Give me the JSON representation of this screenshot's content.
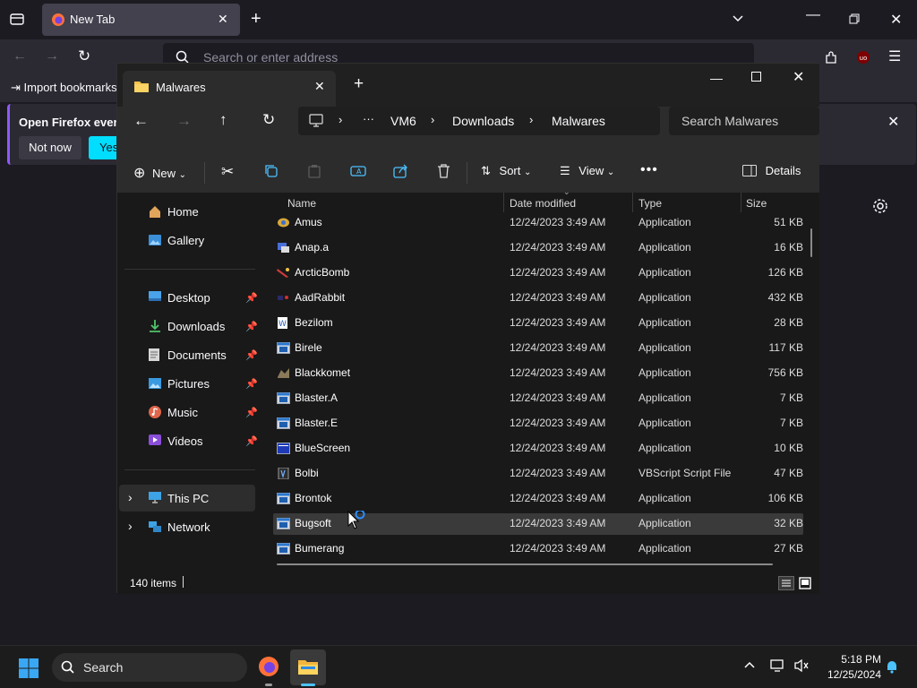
{
  "browser": {
    "tab_title": "New Tab",
    "url_placeholder": "Search or enter address",
    "bookmark_import": "Import bookmarks",
    "notification": {
      "text": "Open Firefox every",
      "not_now": "Not now",
      "yes": "Yes,"
    }
  },
  "explorer": {
    "tab_title": "Malwares",
    "breadcrumb": [
      "VM6",
      "Downloads",
      "Malwares"
    ],
    "search_placeholder": "Search Malwares",
    "commands": {
      "new": "New",
      "sort": "Sort",
      "view": "View",
      "details": "Details"
    },
    "nav": {
      "home": "Home",
      "gallery": "Gallery",
      "desktop": "Desktop",
      "downloads": "Downloads",
      "documents": "Documents",
      "pictures": "Pictures",
      "music": "Music",
      "videos": "Videos",
      "this_pc": "This PC",
      "network": "Network"
    },
    "columns": {
      "name": "Name",
      "date": "Date modified",
      "type": "Type",
      "size": "Size"
    },
    "files": [
      {
        "name": "Amus",
        "date": "12/24/2023 3:49 AM",
        "type": "Application",
        "size": "51 KB",
        "icon": "amus-icon"
      },
      {
        "name": "Anap.a",
        "date": "12/24/2023 3:49 AM",
        "type": "Application",
        "size": "16 KB",
        "icon": "anap-icon"
      },
      {
        "name": "ArcticBomb",
        "date": "12/24/2023 3:49 AM",
        "type": "Application",
        "size": "126 KB",
        "icon": "arcticbomb-icon"
      },
      {
        "name": "AadRabbit",
        "date": "12/24/2023 3:49 AM",
        "type": "Application",
        "size": "432 KB",
        "icon": "aadrabbit-icon"
      },
      {
        "name": "Bezilom",
        "date": "12/24/2023 3:49 AM",
        "type": "Application",
        "size": "28 KB",
        "icon": "word-doc-icon"
      },
      {
        "name": "Birele",
        "date": "12/24/2023 3:49 AM",
        "type": "Application",
        "size": "117 KB",
        "icon": "app-window-icon"
      },
      {
        "name": "Blackkomet",
        "date": "12/24/2023 3:49 AM",
        "type": "Application",
        "size": "756 KB",
        "icon": "blackkomet-icon"
      },
      {
        "name": "Blaster.A",
        "date": "12/24/2023 3:49 AM",
        "type": "Application",
        "size": "7 KB",
        "icon": "app-window-icon"
      },
      {
        "name": "Blaster.E",
        "date": "12/24/2023 3:49 AM",
        "type": "Application",
        "size": "7 KB",
        "icon": "app-window-icon"
      },
      {
        "name": "BlueScreen",
        "date": "12/24/2023 3:49 AM",
        "type": "Application",
        "size": "10 KB",
        "icon": "bluescreen-icon"
      },
      {
        "name": "Bolbi",
        "date": "12/24/2023 3:49 AM",
        "type": "VBScript Script File",
        "size": "47 KB",
        "icon": "vbscript-icon"
      },
      {
        "name": "Brontok",
        "date": "12/24/2023 3:49 AM",
        "type": "Application",
        "size": "106 KB",
        "icon": "app-window-icon"
      },
      {
        "name": "Bugsoft",
        "date": "12/24/2023 3:49 AM",
        "type": "Application",
        "size": "32 KB",
        "icon": "app-window-icon"
      },
      {
        "name": "Bumerang",
        "date": "12/24/2023 3:49 AM",
        "type": "Application",
        "size": "27 KB",
        "icon": "app-window-icon"
      }
    ],
    "status": "140 items"
  },
  "taskbar": {
    "search_placeholder": "Search",
    "time": "5:18 PM",
    "date": "12/25/2024"
  },
  "colors": {
    "accent": "#4cc2ff",
    "selected_row": "#3a3a3a",
    "firefox_accent": "#00ddff"
  }
}
